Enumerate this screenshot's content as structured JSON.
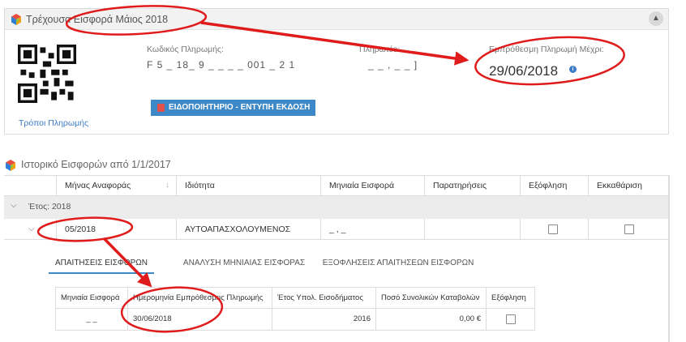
{
  "current_contribution": {
    "title": "Τρέχουσα Εισφορά Μάιος 2018",
    "payment_code_label": "Κωδικός Πληρωμής:",
    "payment_code_value": "F 5 _ 18_ 9  _ _   _ _ 001  _ 2 1",
    "beneficiary_label": "Πληρωτέο:",
    "beneficiary_value": "_ _ , _ _ ]",
    "due_date_label": "Εμπρόθεσμη Πληρωμή Μέχρι:",
    "due_date_value": "29/06/2018",
    "print_button_label": "ΕΙΔΟΠΟΙΗΤΗΡΙΟ - ΕΝΤΥΠΗ ΕΚΔΟΣΗ",
    "payment_methods_link": "Τρόποι Πληρωμής"
  },
  "history": {
    "title": "Ιστορικό Εισφορών από 1/1/2017",
    "columns": [
      "Μήνας Αναφοράς",
      "Ιδιότητα",
      "Μηνιαία Εισφορά",
      "Παρατηρήσεις",
      "Εξόφληση",
      "Εκκαθάριση"
    ],
    "group_label": "Έτος: 2018",
    "row": {
      "month": "05/2018",
      "capacity": "ΑΥΤΟΑΠΑΣΧΟΛΟΥΜΕΝΟΣ",
      "monthly_contribution": "_ , _",
      "notes": "",
      "settled": false,
      "clearance": false
    }
  },
  "tabs": [
    {
      "label": "ΑΠΑΙΤΗΣΕΙΣ ΕΙΣΦΟΡΩΝ",
      "active": true
    },
    {
      "label": "ΑΝΑΛΥΣΗ ΜΗΝΙΑΙΑΣ ΕΙΣΦΟΡΑΣ",
      "active": false
    },
    {
      "label": "ΕΞΟΦΛΗΣΕΙΣ ΑΠΑΙΤΗΣΕΩΝ ΕΙΣΦΟΡΩΝ",
      "active": false
    }
  ],
  "claims_table": {
    "columns": [
      "Μηνιαία Εισφορά",
      "Ημερομηνία Εμπρόθεσμης Πληρωμής",
      "Έτος Υπολ. Εισοδήματος",
      "Ποσό Συνολικών Καταβολών",
      "Εξόφληση"
    ],
    "row": {
      "monthly_contribution": "_ _",
      "due_date": "30/06/2018",
      "income_year": "2016",
      "total_payments": "0,00 €",
      "settled": false
    }
  },
  "colors": {
    "accent": "#3d88c6",
    "annotation_red": "#e01b1b",
    "header_bg": "#f2f2f2",
    "group_bg": "#ececec"
  },
  "icons": [
    "cube-logo-icon",
    "chevron-up-icon",
    "qr-code-icon",
    "info-icon",
    "pdf-icon",
    "sort-arrow-icon",
    "chevron-down-icon",
    "checkbox-icon"
  ]
}
